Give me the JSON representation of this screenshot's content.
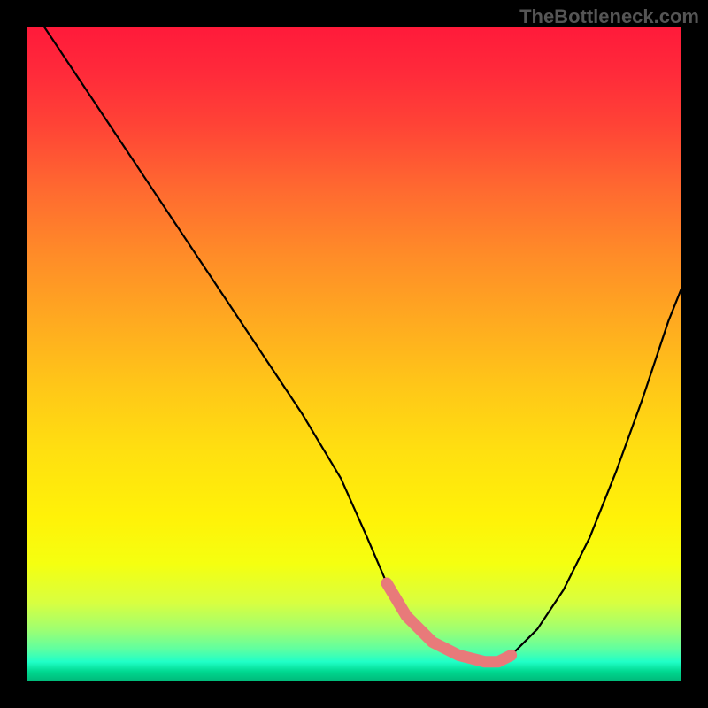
{
  "watermark": "TheBottleneck.com",
  "chart_data": {
    "type": "line",
    "title": "",
    "xlabel": "",
    "ylabel": "",
    "xlim": [
      0,
      100
    ],
    "ylim": [
      0,
      100
    ],
    "series": [
      {
        "name": "curve",
        "x": [
          0,
          6,
          12,
          18,
          24,
          30,
          36,
          42,
          48,
          52,
          55,
          58,
          62,
          66,
          70,
          72,
          74,
          78,
          82,
          86,
          90,
          94,
          98,
          100
        ],
        "values": [
          104,
          95,
          86,
          77,
          68,
          59,
          50,
          41,
          31,
          22,
          15,
          10,
          6,
          4,
          3,
          3,
          4,
          8,
          14,
          22,
          32,
          43,
          55,
          60
        ]
      },
      {
        "name": "highlight",
        "x": [
          55,
          58,
          62,
          66,
          70,
          72,
          74
        ],
        "values": [
          15,
          10,
          6,
          4,
          3,
          3,
          4
        ]
      }
    ],
    "colors": {
      "curve": "#000000",
      "highlight": "#e87a7a"
    }
  }
}
